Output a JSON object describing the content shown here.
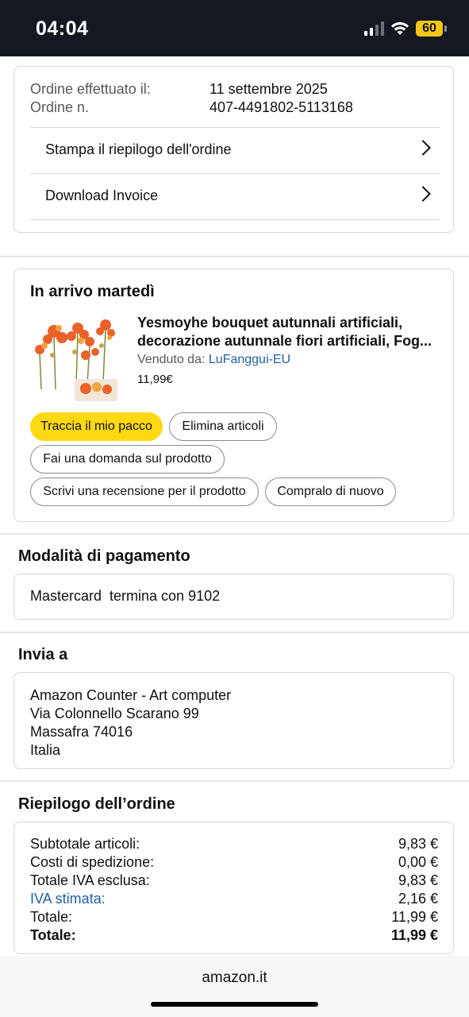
{
  "status_bar": {
    "time": "04:04",
    "battery": "60"
  },
  "order_info": {
    "placed_label": "Ordine effettuato il:",
    "placed_value": "11 settembre 2025",
    "number_label": "Ordine n.",
    "number_value": "407-4491802-5113168",
    "links": [
      {
        "label": "Stampa il riepilogo dell'ordine"
      },
      {
        "label": "Download Invoice"
      }
    ]
  },
  "shipment": {
    "heading": "In arrivo martedì",
    "product_title": "Yesmoyhe bouquet autunnali artificiali, decorazione autunnale fiori artificiali, Fog...",
    "seller_prefix": "Venduto da:",
    "seller_name": "LuFanggui-EU",
    "price": "11,99€",
    "buttons": {
      "track": "Traccia il mio pacco",
      "delete": "Elimina articoli",
      "ask": "Fai una domanda sul prodotto",
      "review": "Scrivi una recensione per il prodotto",
      "buy_again": "Compralo di nuovo"
    }
  },
  "payment": {
    "heading": "Modalità di pagamento",
    "method": "Mastercard  termina con 9102"
  },
  "shipping_address": {
    "heading": "Invia a",
    "lines": [
      "Amazon Counter - Art computer",
      "Via Colonnello Scarano 99",
      "Massafra 74016",
      "Italia"
    ]
  },
  "summary": {
    "heading": "Riepilogo dell’ordine",
    "rows": [
      {
        "label": "Subtotale articoli:",
        "value": "9,83 €"
      },
      {
        "label": "Costi di spedizione:",
        "value": "0,00 €"
      },
      {
        "label": "Totale IVA esclusa:",
        "value": "9,83 €"
      },
      {
        "label": "IVA stimata:",
        "value": "2,16 €"
      },
      {
        "label": "Totale:",
        "value": "11,99 €"
      },
      {
        "label": "Totale:",
        "value": "11,99 €"
      }
    ]
  },
  "footer": {
    "domain": "amazon.it"
  },
  "colors": {
    "accent": "#ffd814",
    "link": "#2162a1",
    "status_bar": "#141921"
  },
  "icons": [
    "signal-icon",
    "wifi-icon",
    "battery-icon",
    "chevron-right-icon"
  ]
}
